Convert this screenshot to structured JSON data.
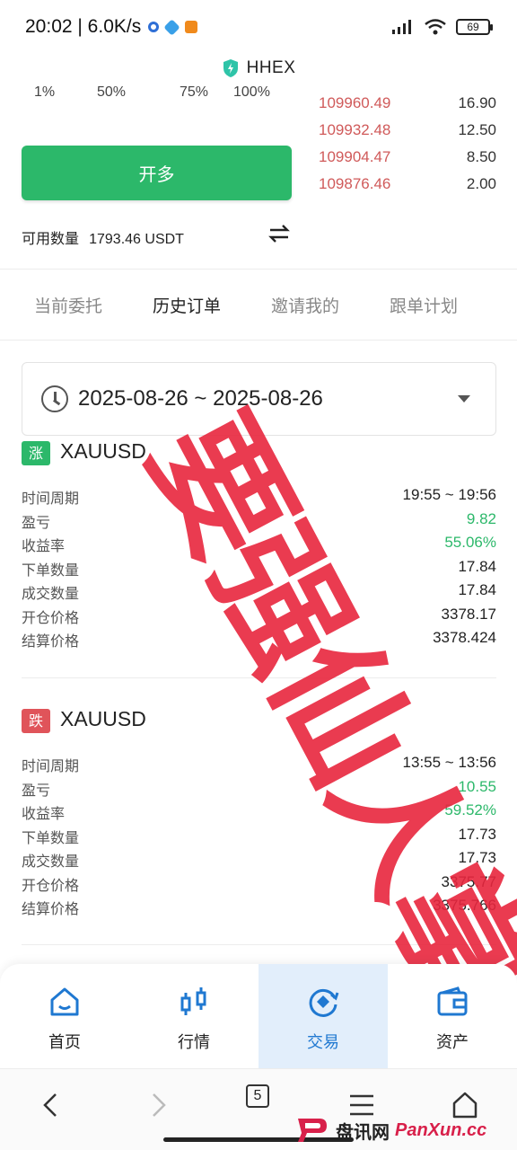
{
  "status_bar": {
    "time": "20:02 | 6.0K/s",
    "battery": "69"
  },
  "app": {
    "title": "HHEX"
  },
  "percent_row": [
    "1%",
    "50%",
    "75%",
    "100%"
  ],
  "order_book": [
    {
      "price": "109960.49",
      "qty": "16.90"
    },
    {
      "price": "109932.48",
      "qty": "12.50"
    },
    {
      "price": "109904.47",
      "qty": "8.50"
    },
    {
      "price": "109876.46",
      "qty": "2.00"
    }
  ],
  "trade": {
    "long_button": "开多",
    "available_label": "可用数量",
    "available_value": "1793.46 USDT"
  },
  "tabs": [
    "当前委托",
    "历史订单",
    "邀请我的",
    "跟单计划"
  ],
  "date_filter": {
    "range": "2025-08-26 ~ 2025-08-26"
  },
  "orders": [
    {
      "badge": "涨",
      "badge_color": "#2cb86a",
      "symbol": "XAUUSD",
      "rows": [
        {
          "k": "时间周期",
          "v": "19:55 ~ 19:56"
        },
        {
          "k": "盈亏",
          "v": "9.82"
        },
        {
          "k": "收益率",
          "v": "55.06%"
        },
        {
          "k": "下单数量",
          "v": "17.84"
        },
        {
          "k": "成交数量",
          "v": "17.84"
        },
        {
          "k": "开仓价格",
          "v": "3378.17"
        },
        {
          "k": "结算价格",
          "v": "3378.424"
        }
      ]
    },
    {
      "badge": "跌",
      "badge_color": "#e0545a",
      "symbol": "XAUUSD",
      "rows": [
        {
          "k": "时间周期",
          "v": "13:55 ~ 13:56"
        },
        {
          "k": "盈亏",
          "v": "10.55"
        },
        {
          "k": "收益率",
          "v": "59.52%"
        },
        {
          "k": "下单数量",
          "v": "17.73"
        },
        {
          "k": "成交数量",
          "v": "17.73"
        },
        {
          "k": "开仓价格",
          "v": "3375.77"
        },
        {
          "k": "结算价格",
          "v": "3375.766"
        }
      ]
    }
  ],
  "bottom_nav": [
    {
      "label": "首页",
      "icon": "home-icon"
    },
    {
      "label": "行情",
      "icon": "candlestick-icon"
    },
    {
      "label": "交易",
      "icon": "trade-icon",
      "active": true
    },
    {
      "label": "资产",
      "icon": "wallet-icon"
    }
  ],
  "system_nav": {
    "tab_count": "5"
  },
  "overlay_text": "要强仙人掌",
  "watermark": {
    "cn": "盘讯网",
    "en": "PanXun.cc"
  },
  "colors": {
    "green": "#2cb86a",
    "red_price": "#d05a5a",
    "active_blue": "#1f78d1",
    "stamp_red": "#e8263e"
  }
}
